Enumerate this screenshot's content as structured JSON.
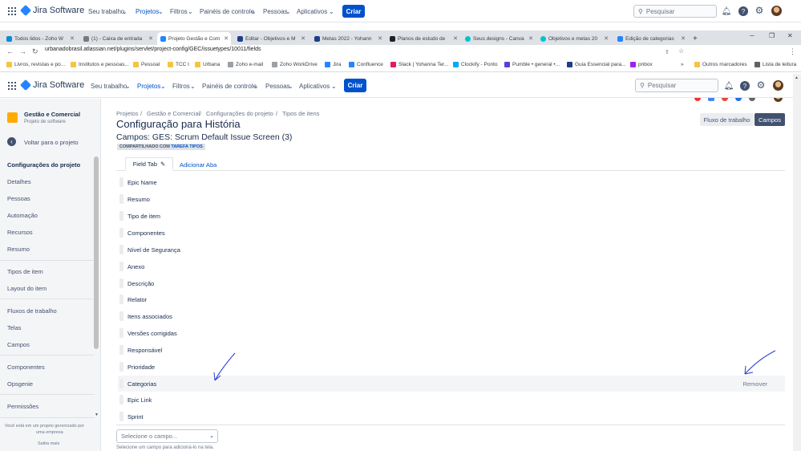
{
  "app_top": {
    "brand": "Jira Software",
    "nav": [
      "Seu trabalho",
      "Projetos",
      "Filtros",
      "Painéis de controle",
      "Pessoas",
      "Aplicativos"
    ],
    "create_label": "Criar",
    "search_placeholder": "Pesquisar"
  },
  "browser": {
    "tabs": [
      {
        "title": "Todos lidos - Zoho W",
        "color": "#0b8bd9"
      },
      {
        "title": "(1) - Caixa de entrada",
        "color": "#7a7a7a"
      },
      {
        "title": "Projeto Gestão e Com",
        "color": "#2684ff"
      },
      {
        "title": "Editar - Objetivos e M",
        "color": "#1d3f8a"
      },
      {
        "title": "Metas 2022 - Yohann",
        "color": "#1d3f8a"
      },
      {
        "title": "Planos de estudo de",
        "color": "#222222"
      },
      {
        "title": "Seus designs - Canva",
        "color": "#00c4cc"
      },
      {
        "title": "Objetivos e metas 20",
        "color": "#00c4cc"
      },
      {
        "title": "Edição de categorias",
        "color": "#2684ff"
      }
    ],
    "address": "urbanadobrasil.atlassian.net/plugins/servlet/project-config/GEC/issuetypes/10011/fields",
    "bookmarks": [
      {
        "label": "Livros, revistas e po...",
        "color": "#f5c542"
      },
      {
        "label": "Institutos e pessoas...",
        "color": "#f5c542"
      },
      {
        "label": "Pessoal",
        "color": "#f5c542"
      },
      {
        "label": "TCC I",
        "color": "#f5c542"
      },
      {
        "label": "Urbana",
        "color": "#f5c542"
      },
      {
        "label": "Zoho e-mail",
        "color": "#9aa0a6"
      },
      {
        "label": "Zoho WorkDrive",
        "color": "#9aa0a6"
      },
      {
        "label": "Jira",
        "color": "#2684ff"
      },
      {
        "label": "Confluence",
        "color": "#2684ff"
      },
      {
        "label": "Slack | Yohanna Ter...",
        "color": "#e01e5a"
      },
      {
        "label": "Clockify - Ponto",
        "color": "#03a9f4"
      },
      {
        "label": "Pumble • general •...",
        "color": "#5b3fd6"
      },
      {
        "label": "Guia Essencial para...",
        "color": "#1d3f8a"
      },
      {
        "label": "pnbox",
        "color": "#a020f0"
      },
      {
        "label": "Outros marcadores",
        "color": "#f5c542"
      },
      {
        "label": "Lista de leitura",
        "color": "#5f6368"
      }
    ],
    "overflow_glyph": "»"
  },
  "sidebar": {
    "project_name": "Gestão e Comercial",
    "project_type": "Projeto de software",
    "back_label": "Voltar para o projeto",
    "section_title": "Configurações do projeto",
    "groups": [
      [
        "Detalhes",
        "Pessoas",
        "Automação",
        "Recursos",
        "Resumo"
      ],
      [
        "Tipos de item",
        "Layout do item"
      ],
      [
        "Fluxos de trabalho",
        "Telas",
        "Campos"
      ],
      [
        "Componentes",
        "Opsgenie"
      ],
      [
        "Permissões"
      ]
    ],
    "footer_text_1": "Você está em um projeto gerenciado por",
    "footer_text_2": "uma empresa",
    "footer_link": "Saiba mais"
  },
  "main": {
    "breadcrumb": [
      "Projetos",
      "Gestão e Comercial",
      "Configurações do projeto",
      "Tipos de itens"
    ],
    "breadcrumb_sep": "/",
    "title": "Configuração para História",
    "subtitle": "Campos: GES: Scrum Default Issue Screen (3)",
    "shared_prefix": "Compartilhado com",
    "shared_link": "Tarefa tipos",
    "btn_workflow": "Fluxo de trabalho",
    "btn_fields": "Campos",
    "tab_label": "Field Tab",
    "add_tab": "Adicionar Aba",
    "fields": [
      "Epic Name",
      "Resumo",
      "Tipo de item",
      "Componentes",
      "Nível de Segurança",
      "Anexo",
      "Descrição",
      "Relator",
      "Itens associados",
      "Versões corrigidas",
      "Responsável",
      "Prioridade",
      "Categorias",
      "Epic Link",
      "Sprint"
    ],
    "remove_label": "Remover",
    "select_placeholder": "Selecione o campo...",
    "hint": "Selecione um campo para adicioná-lo na tela."
  },
  "colors": {
    "primary": "#0052cc",
    "project_icon": "#ffab00",
    "annotation": "#2a3bd1"
  }
}
